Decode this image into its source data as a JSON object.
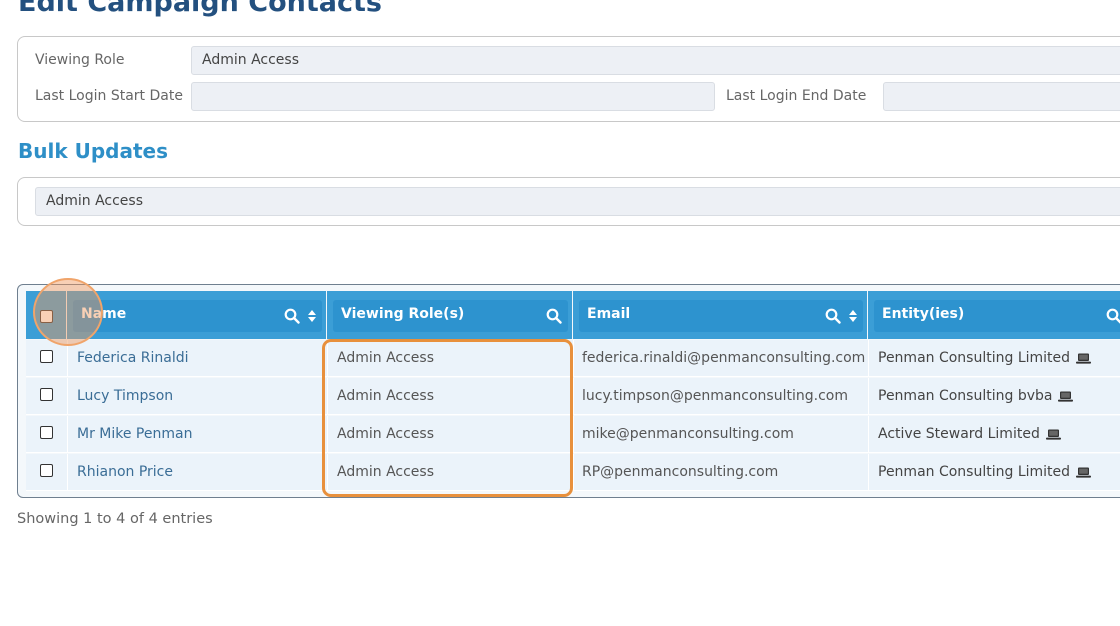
{
  "page": {
    "title": "Edit Campaign Contacts"
  },
  "filters": {
    "viewing_role_label": "Viewing Role",
    "viewing_role_value": "Admin Access",
    "last_login_start_label": "Last Login Start Date",
    "last_login_start_value": "",
    "last_login_end_label": "Last Login End Date",
    "last_login_end_value": ""
  },
  "bulk": {
    "title": "Bulk Updates",
    "value": "Admin Access"
  },
  "table": {
    "columns": [
      {
        "label": "Name"
      },
      {
        "label": "Viewing Role(s)"
      },
      {
        "label": "Email"
      },
      {
        "label": "Entity(ies)"
      }
    ],
    "rows": [
      {
        "name": "Federica Rinaldi",
        "role": "Admin Access",
        "email": "federica.rinaldi@penmanconsulting.com",
        "entity": "Penman Consulting Limited"
      },
      {
        "name": "Lucy Timpson",
        "role": "Admin Access",
        "email": "lucy.timpson@penmanconsulting.com",
        "entity": "Penman Consulting bvba"
      },
      {
        "name": "Mr Mike Penman",
        "role": "Admin Access",
        "email": "mike@penmanconsulting.com",
        "entity": "Active Steward Limited"
      },
      {
        "name": "Rhianon Price",
        "role": "Admin Access",
        "email": "RP@penmanconsulting.com",
        "entity": "Penman Consulting Limited"
      }
    ],
    "info": "Showing 1 to 4 of 4 entries"
  },
  "icons": [
    "search-icon",
    "sort-icon",
    "laptop-icon",
    "checkbox"
  ],
  "colors": {
    "title": "#23507f",
    "section_title": "#2e8fc7",
    "header_bg": "#3b9ed6",
    "highlight": "#e8903c"
  }
}
